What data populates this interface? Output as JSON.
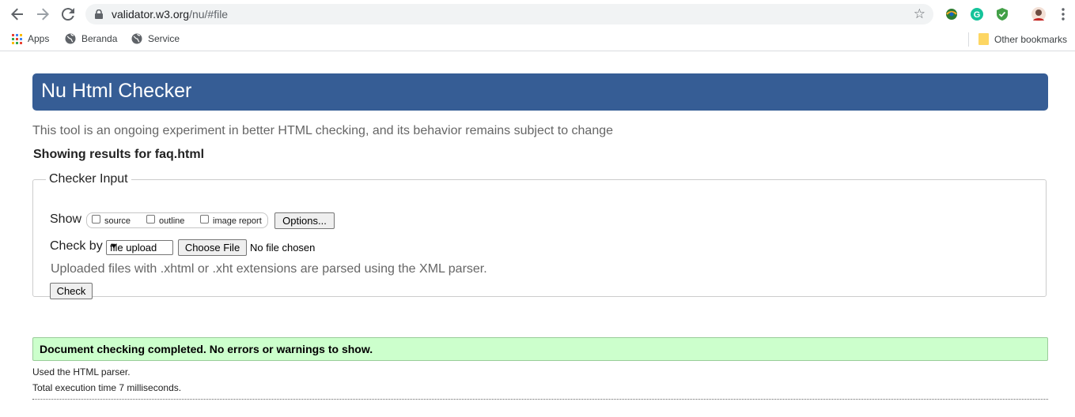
{
  "browser": {
    "url_host": "validator.w3.org",
    "url_path": "/nu/#file",
    "bookmarks": [
      {
        "label": "Apps",
        "icon": "apps-grid-icon"
      },
      {
        "label": "Beranda",
        "icon": "globe-icon"
      },
      {
        "label": "Service",
        "icon": "globe-icon"
      }
    ],
    "other_bookmarks": "Other bookmarks"
  },
  "page": {
    "title": "Nu Html Checker",
    "tagline": "This tool is an ongoing experiment in better HTML checking, and its behavior remains subject to change",
    "showing": "Showing results for faq.html"
  },
  "checker": {
    "legend": "Checker Input",
    "show_label": "Show",
    "show_options": [
      "source",
      "outline",
      "image report"
    ],
    "options_button": "Options...",
    "check_by_label": "Check by",
    "check_by_value": "file upload",
    "choose_file_button": "Choose File",
    "file_status": "No file chosen",
    "hint": "Uploaded files with .xhtml or .xht extensions are parsed using the XML parser.",
    "check_button": "Check"
  },
  "results": {
    "success_message": "Document checking completed. No errors or warnings to show.",
    "parser": "Used the HTML parser.",
    "exec_time": "Total execution time 7 milliseconds."
  },
  "colors": {
    "banner": "#365d95",
    "success_bg": "#ccffcc"
  }
}
